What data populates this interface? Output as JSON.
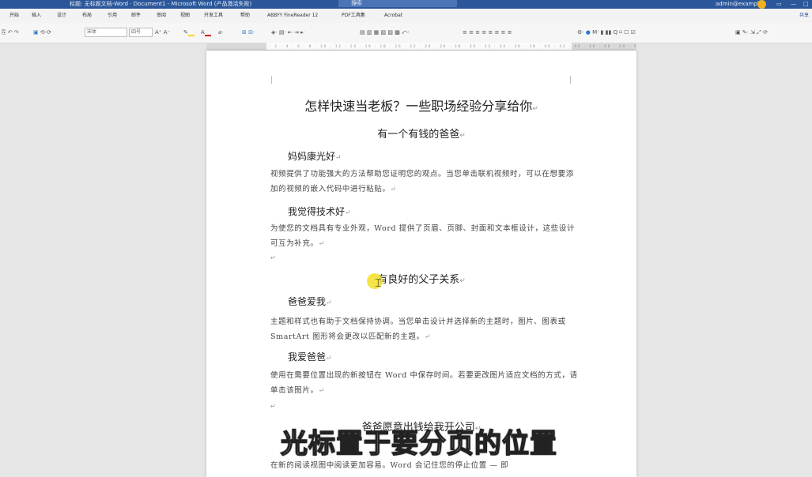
{
  "titlebar": {
    "text": "标题:  无标题文档-Word  ·  Document1 - Microsoft Word (产品激活失败)",
    "search_placeholder": "搜索",
    "user": "admin@example",
    "colors": {
      "bar": "#2b579a",
      "avatar": "#f2b01e"
    }
  },
  "menubar": {
    "tabs": [
      "开始",
      "插入",
      "设计",
      "布局",
      "引用",
      "邮件",
      "审阅",
      "视图",
      "开发工具",
      "帮助",
      "ABBYY FineReader 12",
      "PDF工具集",
      "Acrobat"
    ],
    "share": "共享"
  },
  "toolbar": {
    "font_name": "宋体",
    "font_size": "四号",
    "groups": [
      "粘贴 ↶",
      "Aᴬ Aᵃ",
      "B I U",
      "≡ ≡ ≡ ≡",
      "样式"
    ]
  },
  "document": {
    "title": "怎样快速当老板？一些职场经验分享给你",
    "sections": [
      {
        "heading": "有一个有钱的爸爸",
        "subsections": [
          {
            "heading": "妈妈康光好",
            "text": "视频提供了功能强大的方法帮助您证明您的观点。当您单击联机视频时，可以在想要添加的视频的嵌入代码中进行粘贴。"
          },
          {
            "heading": "我觉得技术好",
            "text": "为使您的文档具有专业外观，Word 提供了页眉、页脚、封面和文本框设计，这些设计可互为补充。"
          }
        ]
      },
      {
        "heading": "有良好的父子关系",
        "subsections": [
          {
            "heading": "爸爸爱我",
            "text": "主题和样式也有助于文档保持协调。当您单击设计并选择新的主题时，图片、图表或 SmartArt 图形将会更改以匹配新的主题。"
          },
          {
            "heading": "我爱爸爸",
            "text": "使用在需要位置出现的新按钮在 Word 中保存时间。若要更改图片适应文档的方式，请单击该图片。"
          }
        ]
      },
      {
        "heading": "爸爸愿意出钱给我开公司",
        "subsections": [
          {
            "heading": "",
            "text": "在新的阅读视图中阅读更加容易。Word 会记住您的停止位置 — 即"
          }
        ]
      }
    ],
    "para_mark": "↵"
  },
  "overlay": {
    "subtitle": "光标置于要分页的位置"
  }
}
